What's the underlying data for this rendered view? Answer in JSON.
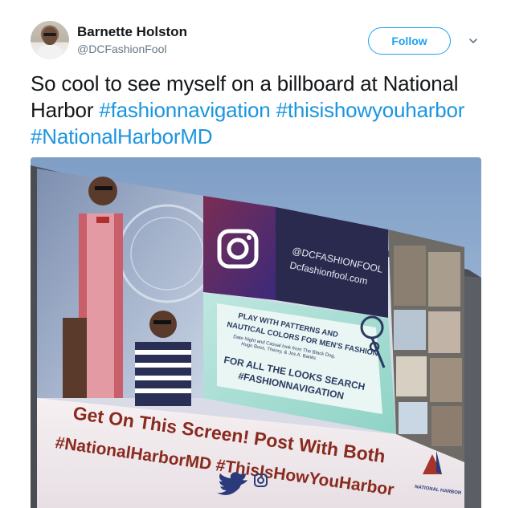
{
  "tweet": {
    "author_name": "Barnette Holston",
    "author_handle": "@DCFashionFool",
    "follow_label": "Follow",
    "text_plain": "So cool to see myself on a billboard at National Harbor",
    "hashtags": [
      "#fashionnavigation",
      "#thisishowyouharbor",
      "#NationalHarborMD"
    ]
  },
  "billboard": {
    "handle_upper": "@DCFASHIONFOOL",
    "website": "Dcfashionfool.com",
    "line1": "PLAY WITH PATTERNS AND",
    "line2": "NAUTICAL COLORS FOR MEN'S FASHION",
    "small1": "Date Night and Casual look from The Black Dog,",
    "small2": "Hugo Boss, Theory, & Jos A. Banks",
    "search_line": "FOR ALL THE LOOKS SEARCH",
    "search_tag": "#FASHIONNAVIGATION",
    "cta1": "Get On This Screen! Post With Both",
    "cta2": "#NationalHarborMD #ThisIsHowYouHarbor",
    "logo_text": "NATIONAL HARBOR"
  },
  "colors": {
    "link": "#1b95e0",
    "follow": "#1da1f2",
    "text": "#14171a",
    "muted": "#657786"
  },
  "icons": [
    "chevron-down-icon",
    "instagram-icon",
    "twitter-icon",
    "map-pin-icon"
  ]
}
